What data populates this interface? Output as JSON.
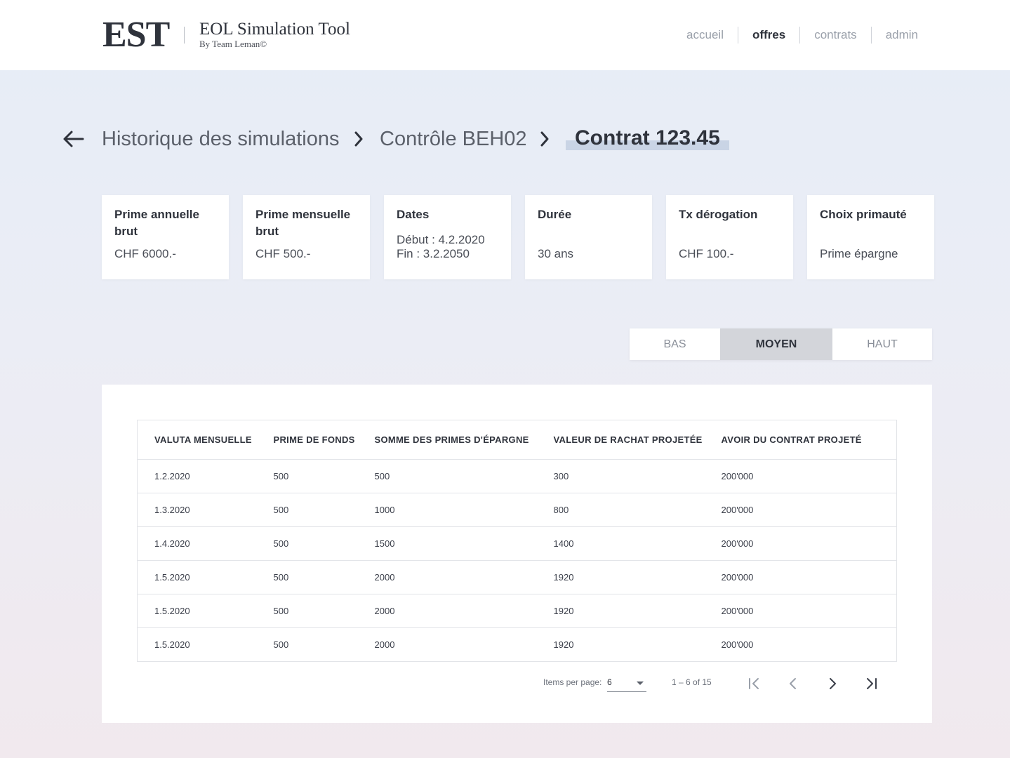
{
  "header": {
    "logo": "EST",
    "app_title": "EOL Simulation Tool",
    "app_subtitle": "By Team Leman©",
    "nav": [
      {
        "label": "accueil",
        "active": false
      },
      {
        "label": "offres",
        "active": true
      },
      {
        "label": "contrats",
        "active": false
      },
      {
        "label": "admin",
        "active": false
      }
    ]
  },
  "breadcrumb": {
    "items": [
      "Historique des simulations",
      "Contrôle BEH02"
    ],
    "current": "Contrat 123.45"
  },
  "cards": [
    {
      "title": "Prime annuelle brut",
      "value": "CHF 6000.-"
    },
    {
      "title": "Prime mensuelle brut",
      "value": "CHF 500.-"
    },
    {
      "title": "Dates",
      "value_line1": "Début : 4.2.2020",
      "value_line2": "Fin : 3.2.2050"
    },
    {
      "title": "Durée",
      "value": "30 ans"
    },
    {
      "title": "Tx dérogation",
      "value": "CHF 100.-"
    },
    {
      "title": "Choix primauté",
      "value": "Prime épargne"
    }
  ],
  "scenario_toggle": {
    "options": [
      "BAS",
      "MOYEN",
      "HAUT"
    ],
    "selected": "MOYEN"
  },
  "table": {
    "columns": [
      "VALUTA MENSUELLE",
      "PRIME DE FONDS",
      "SOMME DES PRIMES D'ÉPARGNE",
      "VALEUR DE RACHAT PROJETÉE",
      "AVOIR DU CONTRAT PROJETÉ"
    ],
    "rows": [
      [
        "1.2.2020",
        "500",
        "500",
        "300",
        "200'000"
      ],
      [
        "1.3.2020",
        "500",
        "1000",
        "800",
        "200'000"
      ],
      [
        "1.4.2020",
        "500",
        "1500",
        "1400",
        "200'000"
      ],
      [
        "1.5.2020",
        "500",
        "2000",
        "1920",
        "200'000"
      ],
      [
        "1.5.2020",
        "500",
        "2000",
        "1920",
        "200'000"
      ],
      [
        "1.5.2020",
        "500",
        "2000",
        "1920",
        "200'000"
      ]
    ]
  },
  "paginator": {
    "items_per_page_label": "Items per page:",
    "items_per_page": "6",
    "range_label": "1 – 6 of 15"
  },
  "colors": {
    "text_dark": "#2f333c",
    "nav_inactive": "#9aa0aa",
    "toggle_selected_bg": "#d3d5da",
    "breadcrumb_highlight": "#c9d4e5"
  }
}
